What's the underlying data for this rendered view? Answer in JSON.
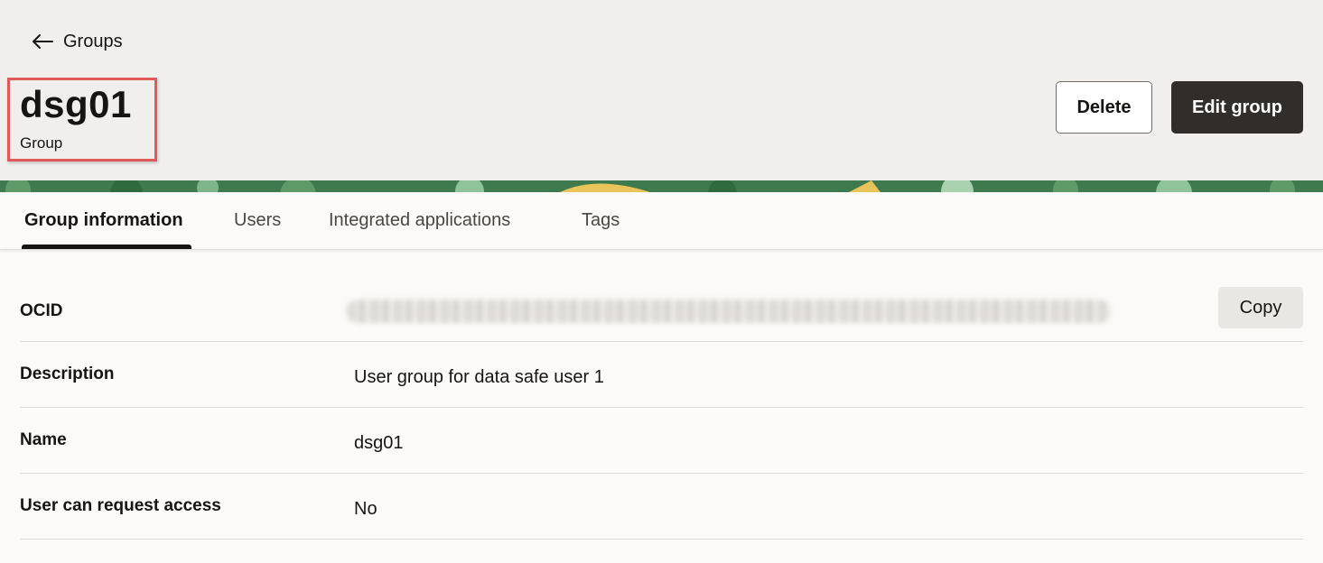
{
  "nav": {
    "back_label": "Groups"
  },
  "page": {
    "title": "dsg01",
    "subtitle": "Group"
  },
  "actions": {
    "delete_label": "Delete",
    "edit_label": "Edit group"
  },
  "tabs": [
    {
      "label": "Group information",
      "active": true
    },
    {
      "label": "Users",
      "active": false
    },
    {
      "label": "Integrated applications",
      "active": false
    },
    {
      "label": "Tags",
      "active": false
    }
  ],
  "details": {
    "ocid": {
      "label": "OCID",
      "copy_label": "Copy"
    },
    "description": {
      "label": "Description",
      "value": "User group for data safe user 1"
    },
    "name": {
      "label": "Name",
      "value": "dsg01"
    },
    "request_access": {
      "label": "User can request access",
      "value": "No"
    }
  },
  "colors": {
    "highlight_border": "#e05a5a",
    "primary_button": "#312d2a",
    "banner_green": "#3f7a4e",
    "banner_accent": "#e8c45a"
  },
  "icons": {
    "back": "arrow-left-icon"
  }
}
